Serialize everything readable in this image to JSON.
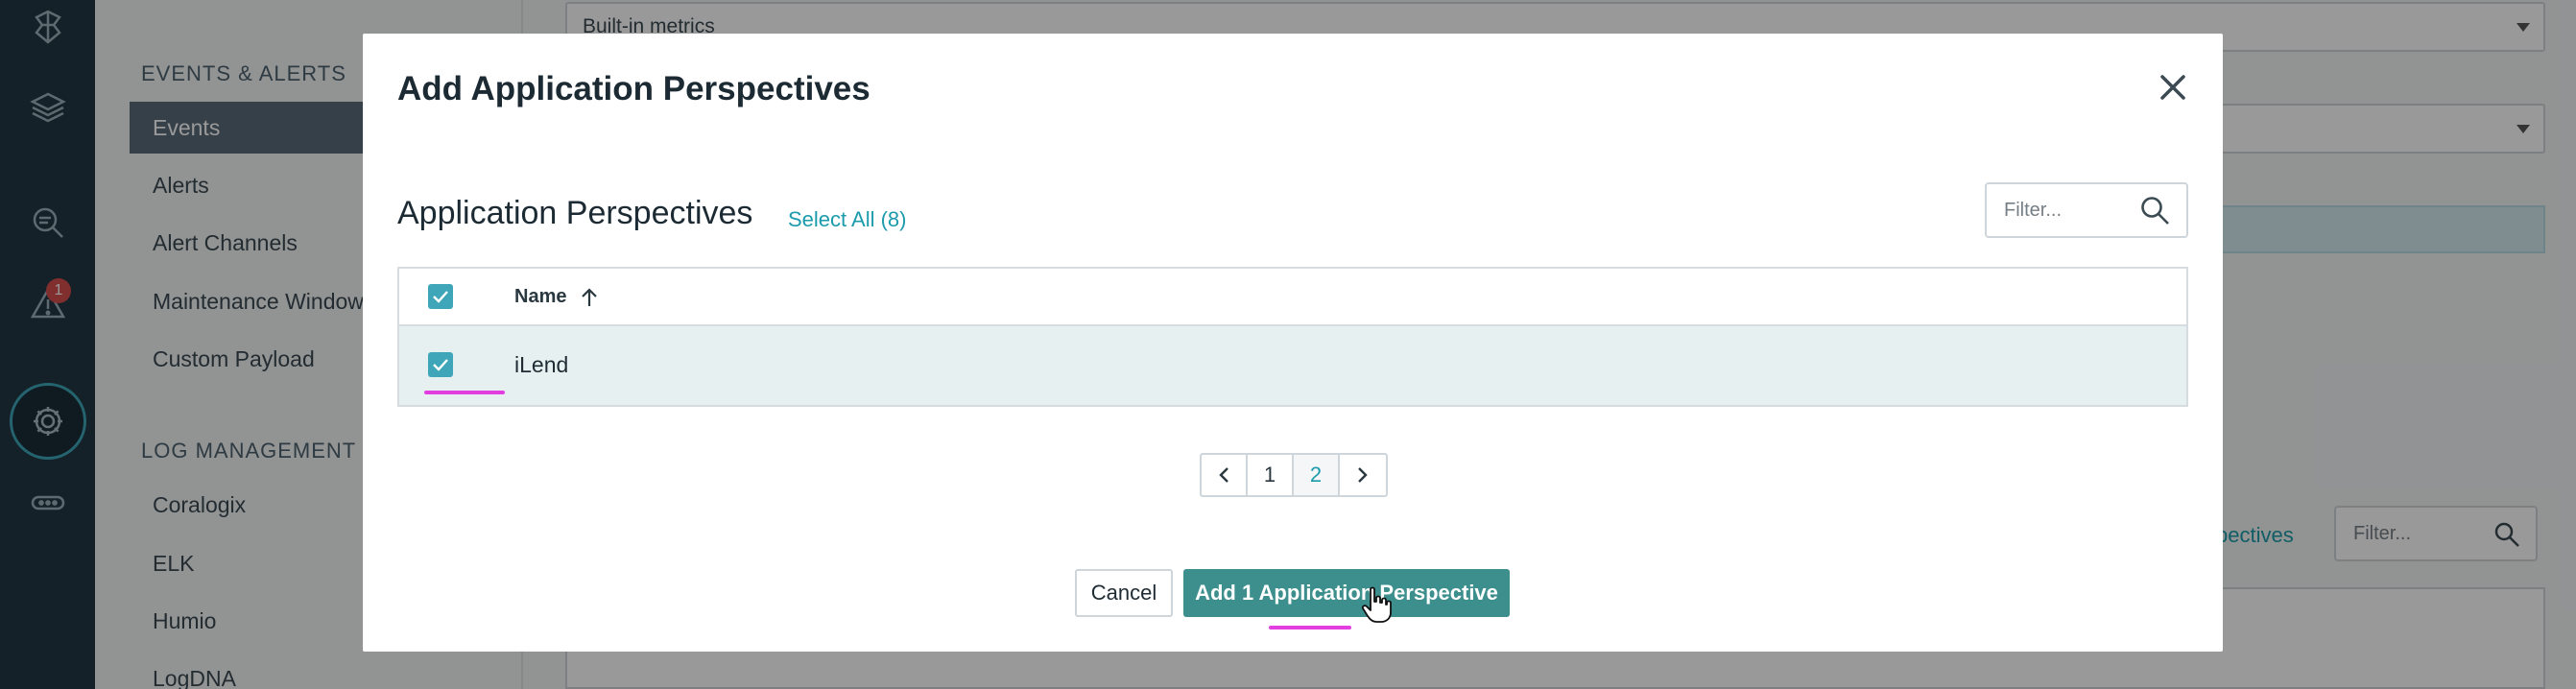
{
  "rail": {
    "alert_badge": "1",
    "icons": [
      "logo-icon",
      "stack-icon",
      "analyze-icon",
      "alert-icon",
      "settings-gear-icon",
      "more-icon"
    ]
  },
  "menu": {
    "events_alerts_heading": "EVENTS & ALERTS",
    "events_items": [
      "Events",
      "Alerts",
      "Alert Channels",
      "Maintenance Windows",
      "Custom Payload"
    ],
    "log_heading": "LOG MANAGEMENT",
    "log_items": [
      "Coralogix",
      "ELK",
      "Humio",
      "LogDNA"
    ]
  },
  "background": {
    "metrics_select": "Built-in metrics",
    "perspectives_link": "pectives",
    "filter_placeholder": "Filter..."
  },
  "modal": {
    "title": "Add Application Perspectives",
    "section_title": "Application Perspectives",
    "select_all": "Select All (8)",
    "filter_placeholder": "Filter...",
    "table": {
      "column_name": "Name",
      "rows": [
        {
          "name": "iLend",
          "checked": true
        }
      ]
    },
    "pagination": {
      "pages": [
        "1",
        "2"
      ],
      "current": "2"
    },
    "cancel_label": "Cancel",
    "add_label": "Add 1 Application Perspective"
  },
  "colors": {
    "accent": "#3ea6b8",
    "primary_button": "#3d8f8e",
    "link": "#1b9bab",
    "rail": "#223744",
    "annotation": "#e33fe0"
  }
}
